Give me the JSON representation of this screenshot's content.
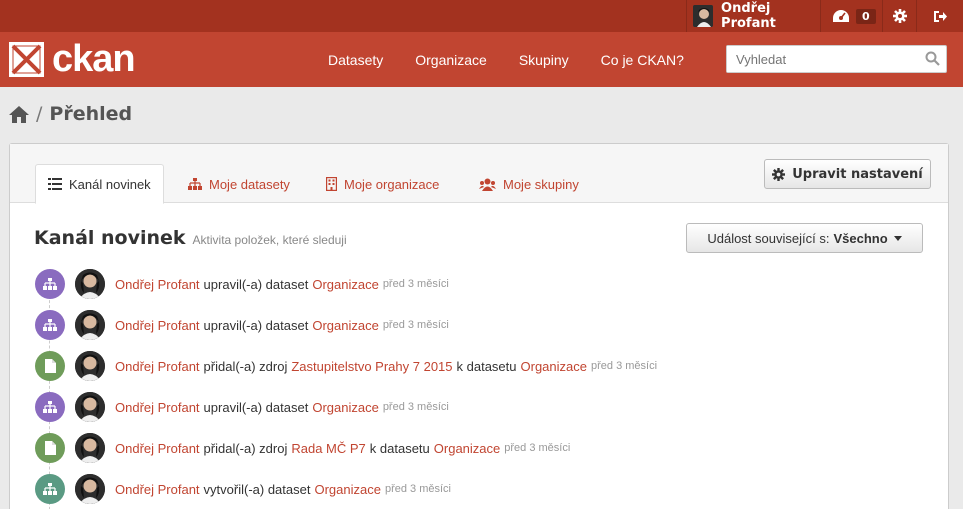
{
  "account": {
    "user_name": "Ondřej Profant",
    "dashboard_count": "0"
  },
  "brand": {
    "logo_text": "ckan"
  },
  "nav": {
    "items": [
      "Datasety",
      "Organizace",
      "Skupiny",
      "Co je CKAN?"
    ]
  },
  "search": {
    "placeholder": "Vyhledat"
  },
  "breadcrumb": {
    "current": "Přehled"
  },
  "tabs": [
    {
      "label": "Kanál novinek",
      "icon": "list-icon"
    },
    {
      "label": "Moje datasety",
      "icon": "sitemap-icon"
    },
    {
      "label": "Moje organizace",
      "icon": "building-icon"
    },
    {
      "label": "Moje skupiny",
      "icon": "group-icon"
    }
  ],
  "settings_button": {
    "label": "Upravit nastavení"
  },
  "main": {
    "title": "Kanál novinek",
    "subtitle": "Aktivita položek, které sleduji",
    "filter_prefix": "Událost související s:",
    "filter_value": "Všechno"
  },
  "colors": {
    "edit": "#8a6bbf",
    "resource": "#6f9c5a",
    "create": "#5a9a83",
    "brand": "#c14531"
  },
  "activities": [
    {
      "type": "edit",
      "user": "Ondřej Profant",
      "verb": "upravil(-a) dataset",
      "target": "Organizace",
      "time": "před 3 měsíci"
    },
    {
      "type": "edit",
      "user": "Ondřej Profant",
      "verb": "upravil(-a) dataset",
      "target": "Organizace",
      "time": "před 3 měsíci"
    },
    {
      "type": "resource",
      "user": "Ondřej Profant",
      "verb": "přidal(-a) zdroj",
      "resource": "Zastupitelstvo Prahy 7 2015",
      "link": "k datasetu",
      "target": "Organizace",
      "time": "před 3 měsíci"
    },
    {
      "type": "edit",
      "user": "Ondřej Profant",
      "verb": "upravil(-a) dataset",
      "target": "Organizace",
      "time": "před 3 měsíci"
    },
    {
      "type": "resource",
      "user": "Ondřej Profant",
      "verb": "přidal(-a) zdroj",
      "resource": "Rada MČ P7",
      "link": "k datasetu",
      "target": "Organizace",
      "time": "před 3 měsíci"
    },
    {
      "type": "create",
      "user": "Ondřej Profant",
      "verb": "vytvořil(-a) dataset",
      "target": "Organizace",
      "time": "před 3 měsíci"
    }
  ]
}
